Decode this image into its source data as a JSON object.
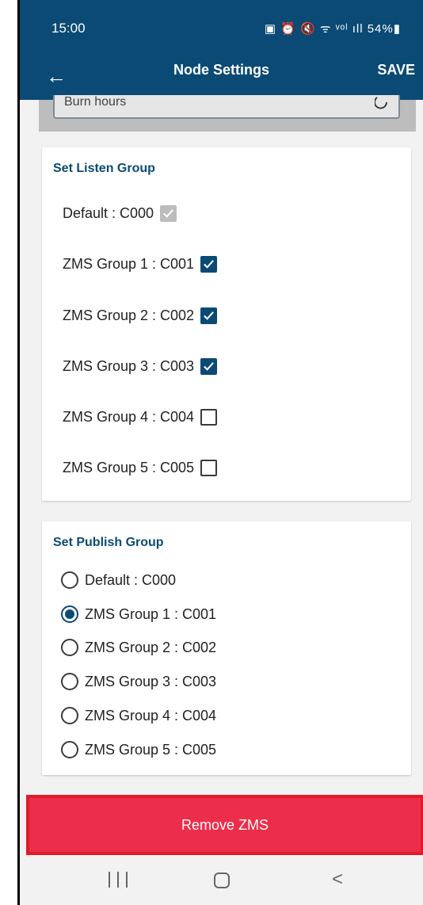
{
  "status_bar": {
    "time": "15:00",
    "icons_text": "▣ ⏰ 🔇 ᯤ ᵛᵒˡ ıll 54%▮"
  },
  "appbar": {
    "back_icon": "arrow-left",
    "title": "Node Settings",
    "save_label": "SAVE"
  },
  "partial_field": {
    "text": "Burn hours"
  },
  "listen_group": {
    "title": "Set Listen Group",
    "items": [
      {
        "label": "Default : C000",
        "checked": true,
        "disabled": true
      },
      {
        "label": "ZMS Group 1 : C001",
        "checked": true,
        "disabled": false
      },
      {
        "label": "ZMS Group 2 : C002",
        "checked": true,
        "disabled": false
      },
      {
        "label": "ZMS Group 3 : C003",
        "checked": true,
        "disabled": false
      },
      {
        "label": "ZMS Group 4 : C004",
        "checked": false,
        "disabled": false
      },
      {
        "label": "ZMS Group 5 : C005",
        "checked": false,
        "disabled": false
      }
    ]
  },
  "publish_group": {
    "title": "Set Publish Group",
    "items": [
      {
        "label": "Default : C000",
        "selected": false
      },
      {
        "label": "ZMS Group 1 : C001",
        "selected": true
      },
      {
        "label": "ZMS Group 2 : C002",
        "selected": false
      },
      {
        "label": "ZMS Group 3 : C003",
        "selected": false
      },
      {
        "label": "ZMS Group 4 : C004",
        "selected": false
      },
      {
        "label": "ZMS Group 5 : C005",
        "selected": false
      }
    ]
  },
  "remove_button": {
    "label": "Remove ZMS"
  },
  "colors": {
    "primary": "#0b4a75",
    "danger": "#ec2e4b"
  }
}
